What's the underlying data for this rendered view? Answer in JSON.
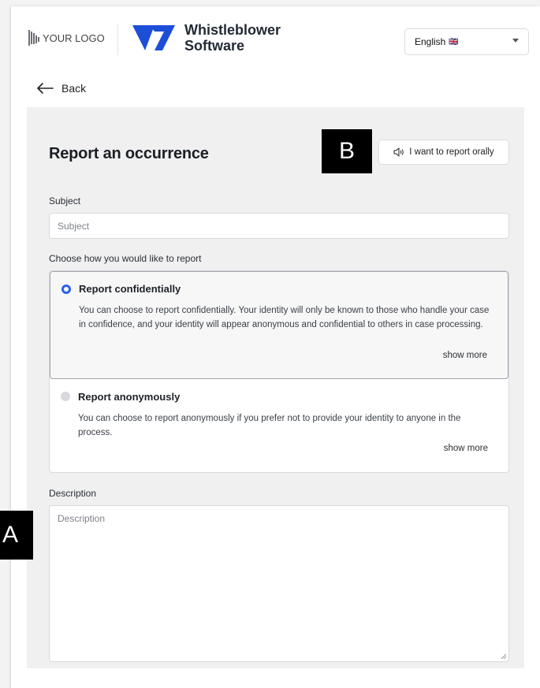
{
  "header": {
    "logo_text": "YOUR LOGO",
    "brand_line1": "Whistleblower",
    "brand_line2": "Software",
    "language": "English",
    "language_flag": "🇬🇧",
    "brand_color": "#1d4ed8"
  },
  "nav": {
    "back_label": "Back"
  },
  "form": {
    "title": "Report an occurrence",
    "oral_button_label": "I want to report orally",
    "subject_label": "Subject",
    "subject_placeholder": "Subject",
    "choose_label": "Choose how you would like to report",
    "options": [
      {
        "title": "Report confidentially",
        "description": "You can choose to report confidentially. Your identity will only be known to those who handle your case in confidence, and your identity will appear anonymous and confidential to others in case processing.",
        "show_more": "show more",
        "selected": true
      },
      {
        "title": "Report anonymously",
        "description": "You can choose to report anonymously if you prefer not to provide your identity to anyone in the process.",
        "show_more": "show more",
        "selected": false
      }
    ],
    "description_label": "Description",
    "description_placeholder": "Description"
  },
  "markers": {
    "a": "A",
    "b": "B"
  },
  "colors": {
    "accent": "#2563eb",
    "panel_bg": "#f0f0f1"
  }
}
